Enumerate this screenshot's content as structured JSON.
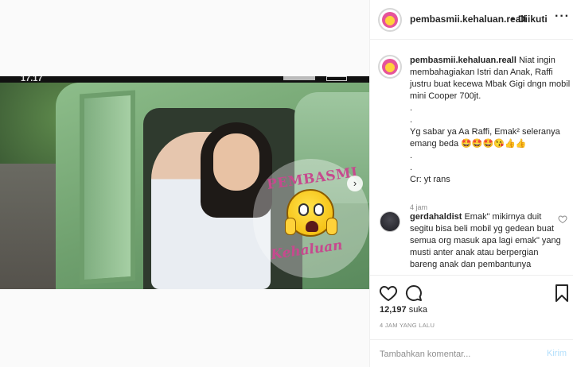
{
  "header": {
    "username": "pembasmii.kehaluan.reall",
    "separator": "•",
    "follow_label": "Diikuti",
    "more_label": "···"
  },
  "media": {
    "status_time": "17.17",
    "watermark_top": "PEMBASMI",
    "watermark_bottom": "Kehaluan",
    "next_arrow": "›"
  },
  "caption": {
    "username": "pembasmii.kehaluan.reall",
    "text": " Niat ingin membahagiakan Istri dan Anak, Raffi justru buat kecewa Mbak Gigi dngn mobil mini Cooper 700jt.\n.\n.\nYg sabar ya Aa Raffi, Emak² seleranya emang beda 🤩🤩🤩😘👍👍\n.\n.\nCr: yt rans",
    "time": "4 jam"
  },
  "comment": {
    "username": "gerdahaldist",
    "text": " Emak\" mikirnya duit segitu bisa beli mobil yg gedean buat semua org masuk apa lagi emak\" yang musti anter anak atau berpergian bareng anak dan pembantunya"
  },
  "actions": {
    "likes_count": "12,197",
    "likes_label": " suka",
    "posted_time": "4 JAM YANG LALU"
  },
  "add_comment": {
    "placeholder": "Tambahkan komentar...",
    "post_label": "Kirim"
  },
  "icons": [
    "more-options-icon",
    "heart-icon",
    "comment-icon",
    "bookmark-icon",
    "next-arrow-icon"
  ],
  "colors": {
    "text": "#262626",
    "muted": "#8e8e8e",
    "post_disabled": "#b2dffc",
    "watermark": "#c64a8e"
  }
}
